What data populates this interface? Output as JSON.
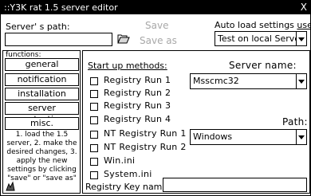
{
  "window": {
    "title": "::Y3K rat 1.5 server editor",
    "close": "X"
  },
  "server_path": {
    "label": "Server' s path:",
    "value": ""
  },
  "actions": {
    "save": "Save",
    "save_as": "Save as"
  },
  "auto_load": {
    "label_prefix": "Auto load settings ",
    "label_underlined": "use",
    "label_suffix": ":",
    "selected": "Test on local Server"
  },
  "functions": {
    "title": "functions:",
    "buttons": [
      "general",
      "notification",
      "installation",
      "server protection",
      "misc."
    ],
    "help": "1. load the 1.5 server, 2. make the desired changes, 3. apply the new settings by clicking \"save\" or \"save as\""
  },
  "startup": {
    "title": "Start up methods:",
    "methods": [
      {
        "label": "Registry Run 1",
        "checked": false
      },
      {
        "label": "Registry Run 2",
        "checked": false
      },
      {
        "label": "Registry Run 3",
        "checked": false
      },
      {
        "label": "Registry Run 4",
        "checked": false
      },
      {
        "label": "NT Registry Run 1",
        "checked": false
      },
      {
        "label": "NT Registry Run 2",
        "checked": false
      },
      {
        "label": "Win.ini",
        "checked": false
      },
      {
        "label": "System.ini",
        "checked": false
      }
    ]
  },
  "server_name": {
    "label": "Server name:",
    "selected": "Msscmc32"
  },
  "path": {
    "label": "Path:",
    "selected": "Windows"
  },
  "registry_key": {
    "label": "Registry Key name:",
    "value": ""
  },
  "colors": {
    "titlebar": "#000000",
    "background": "#ffffff",
    "disabled_text": "#a8a8a8"
  }
}
